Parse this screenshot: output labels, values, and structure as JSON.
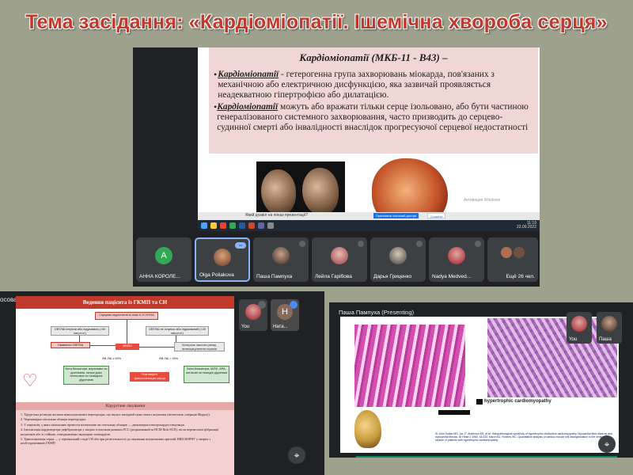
{
  "page": {
    "title": "Тема засідання: «Кардіоміопатії. Ішемічна хвороба серця»"
  },
  "shot1": {
    "slide_header": "Кардіоміопатії (МКБ-11 - B43) –",
    "bullets": [
      {
        "term": "Кардіоміопатії",
        "text": " - гетерогенна група захворювань міокарда, пов'язаних з механічною або електричною дисфункцією, яка зазвичай проявляється неадекватною гіпертрофією або дилатацією."
      },
      {
        "term": "Кардіоміопатії",
        "text": " можуть або вражати тільки серце ізольовано, або бути частиною генералізованого системного захворювання, часто призводить до серцево-судинної смерті або інвалідності внаслідок прогресуючої серцевої недостатності"
      }
    ],
    "windows_watermark": "Активация Windows",
    "bottombar_text": "Який дозвіл на показ презентації?",
    "bottombar_btn1": "Припинити спільний доступ",
    "bottombar_btn2": "Сховати",
    "clock_time": "11:19",
    "clock_date": "22.09.2022",
    "participants": [
      {
        "name": "АННА КОРОЛЕ...",
        "avatar_letter": "A",
        "avatar_color": "#34a853"
      },
      {
        "name": "Olga Poliakova",
        "active": true
      },
      {
        "name": "Паша Пампуха"
      },
      {
        "name": "Лейла Гарібова"
      },
      {
        "name": "Дарья Гриценко"
      },
      {
        "name": "Nadya Medved..."
      },
      {
        "name": "Ещё 26 чел."
      }
    ]
  },
  "shot2": {
    "presenting_label": "осова (Presenting)",
    "slide_title": "Ведення пацієнта із ГКМП та СН",
    "flow": {
      "top": "Серцева недостатність клас II-IV NYHA",
      "left1": "ОВТЛШ існуючи або індукована (>30 мм.рт.ст)",
      "right1": "ОВТЛШ не існуючи або індукований (<30 мм.рт.ст)",
      "left2": "Наявність ОВТЛШ",
      "mid": "ФВЛШ",
      "right2": "Контроль частоти ритму, антикоагулянтна терапія",
      "fv1": "ФВ ЛШ ≥ 50%",
      "fv2": "ФВ ЛШ < 50%",
      "beta": "Бета блокатори, верапаміл чи дилтіазем, низькі дози петльових чи тіазидних діуретиків",
      "heart_tx": "Розглянути трансплантацію серця",
      "beta2": "Бета блокатори, ІАПФ, АРА, петльові чи тіазидні діуретики"
    },
    "surgical_title": "Хірургічне лікування",
    "surgical_items": [
      "1. Хірургічна резекція частини міжшлуночкової перегородки, що звужує вихідний тракт лівого шлуночка (міоектомія, операція Морроу).",
      "2. Черезшкірна септальна абляція перегородки.",
      "3. У пацієнтів, у яких неможливо провести міоектомію чи септальну абляцію — двокамерна електрокардіостимуляція.",
      "4. Імплантація кардіовертера-дефібрилятора у хворих із високим ризиком РСС (розрахований за HCM Risk-SCD), після перенесеної фібриляції шлуночків або зі стійкою, гемодинамічно значущою тахікардією.",
      "5. Трансплантація серця — у термінальній стадії СН або при резистентності до лікування шлуночкових аритмій. ВІКІ ВОРНУ у хворих з необструктивною ГКМП"
    ],
    "tiles": [
      {
        "name": "You"
      },
      {
        "name": "Ната...",
        "avatar_letter": "Н"
      }
    ]
  },
  "shot3": {
    "presenting_label": "Паша Пампуха (Presenting)",
    "caption": "hypertrophic cardiomyopathy",
    "references": "Sr John Sutton MG, Lie JT, Anderson KR, et al. Histopathological specificity of hypertrophic obstructive cardiomyopathy. Myocardial fibre disarray and myocardial fibrosis. Br Heart J 1980; 44:433. Maron BJ, Roberts WC. Quantitative analysis of cardiac muscle cell disorganization in the ventricular septum of patients with hypertrophic cardiomyopathy.",
    "tiles": [
      {
        "name": "You"
      },
      {
        "name": "Паша"
      }
    ]
  }
}
